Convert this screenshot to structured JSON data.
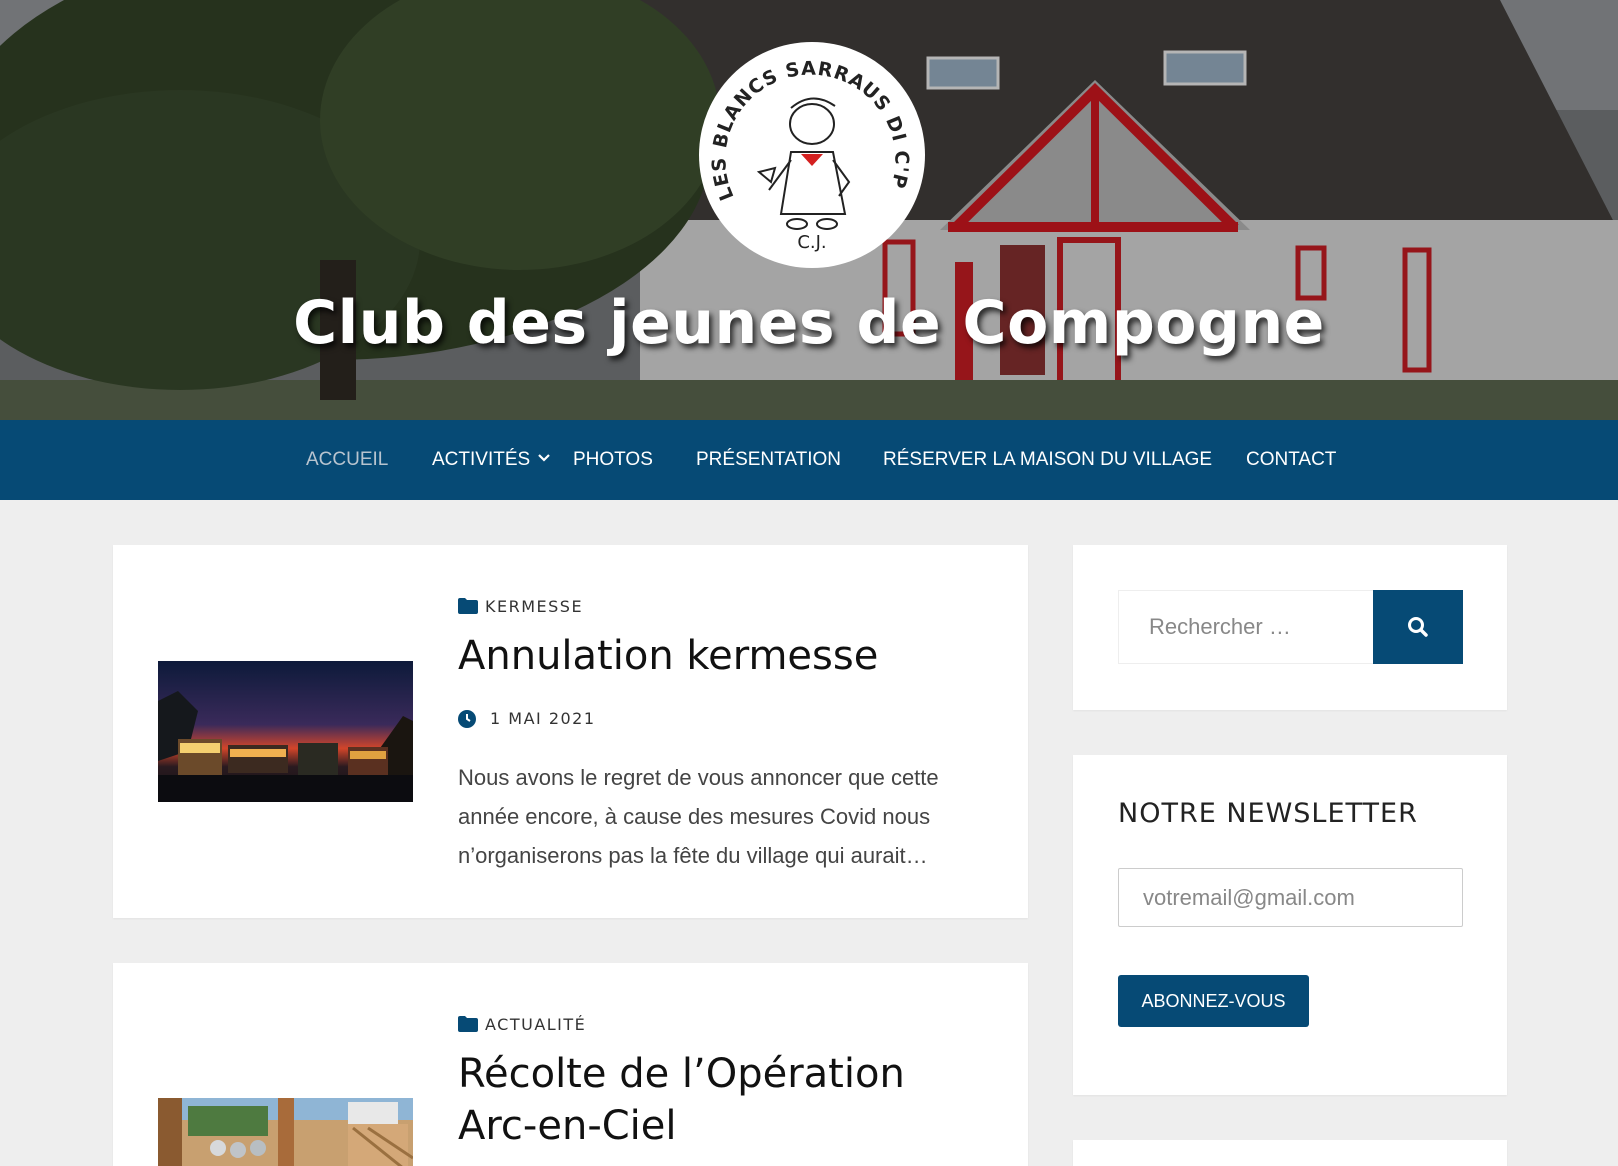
{
  "site": {
    "title": "Club des jeunes de Compogne",
    "logo_text": "LES BLANCS SARRAUS DI C'POGNE",
    "logo_initials": "C.J."
  },
  "nav": {
    "items": [
      {
        "label": "ACCUEIL",
        "active": true
      },
      {
        "label": "ACTIVITÉS",
        "has_submenu": true
      },
      {
        "label": "PHOTOS"
      },
      {
        "label": "PRÉSENTATION"
      },
      {
        "label": "RÉSERVER LA MAISON DU VILLAGE"
      },
      {
        "label": "CONTACT"
      }
    ]
  },
  "posts": [
    {
      "category": "KERMESSE",
      "title": "Annulation kermesse",
      "date": "1 MAI 2021",
      "excerpt_lines": [
        "Nous avons le regret de vous annoncer que cette",
        "année encore, à cause des mesures Covid nous",
        "n’organiserons pas la fête du village qui aurait…"
      ]
    },
    {
      "category": "ACTUALITÉ",
      "title_lines": [
        "Récolte de l’Opération",
        "Arc-en-Ciel"
      ]
    }
  ],
  "sidebar": {
    "search": {
      "placeholder": "Rechercher …"
    },
    "newsletter": {
      "title": "NOTRE NEWSLETTER",
      "email_placeholder": "votremail@gmail.com",
      "button_label": "ABONNEZ-VOUS"
    }
  },
  "colors": {
    "brand_blue": "#064a75",
    "page_bg": "#eeeeee"
  },
  "icons": {
    "category": "folder-icon",
    "date": "clock-icon",
    "search": "search-icon",
    "submenu": "chevron-down-icon"
  }
}
